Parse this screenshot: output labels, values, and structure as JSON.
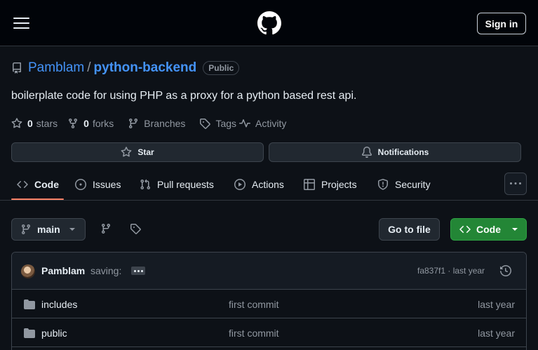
{
  "header": {
    "menu_icon": "hamburger-icon",
    "logo_icon": "github-logo-icon",
    "signin_label": "Sign in"
  },
  "repo": {
    "owner": "Pamblam",
    "separator": "/",
    "name": "python-backend",
    "visibility": "Public",
    "description": "boilerplate code for using PHP as a proxy for a python based rest api.",
    "stars_count": "0",
    "stars_label": "stars",
    "forks_count": "0",
    "forks_label": "forks",
    "branches_label": "Branches",
    "tags_label": "Tags",
    "activity_label": "Activity",
    "star_button": "Star",
    "notifications_button": "Notifications"
  },
  "tabs": [
    {
      "label": "Code",
      "icon": "code-icon",
      "active": true
    },
    {
      "label": "Issues",
      "icon": "issue-icon"
    },
    {
      "label": "Pull requests",
      "icon": "pull-request-icon"
    },
    {
      "label": "Actions",
      "icon": "play-icon"
    },
    {
      "label": "Projects",
      "icon": "table-icon"
    },
    {
      "label": "Security",
      "icon": "shield-icon"
    }
  ],
  "toolbar": {
    "branch": "main",
    "goto_file": "Go to file",
    "code_button": "Code"
  },
  "commit": {
    "author": "Pamblam",
    "message": "saving:",
    "hash_and_time": "fa837f1 · last year"
  },
  "files": [
    {
      "name": "includes",
      "message": "first commit",
      "date": "last year",
      "type": "folder"
    },
    {
      "name": "public",
      "message": "first commit",
      "date": "last year",
      "type": "folder"
    }
  ],
  "colors": {
    "link": "#4493f8",
    "primary_button": "#238636",
    "tab_underline": "#f78166",
    "background": "#0d1117"
  }
}
